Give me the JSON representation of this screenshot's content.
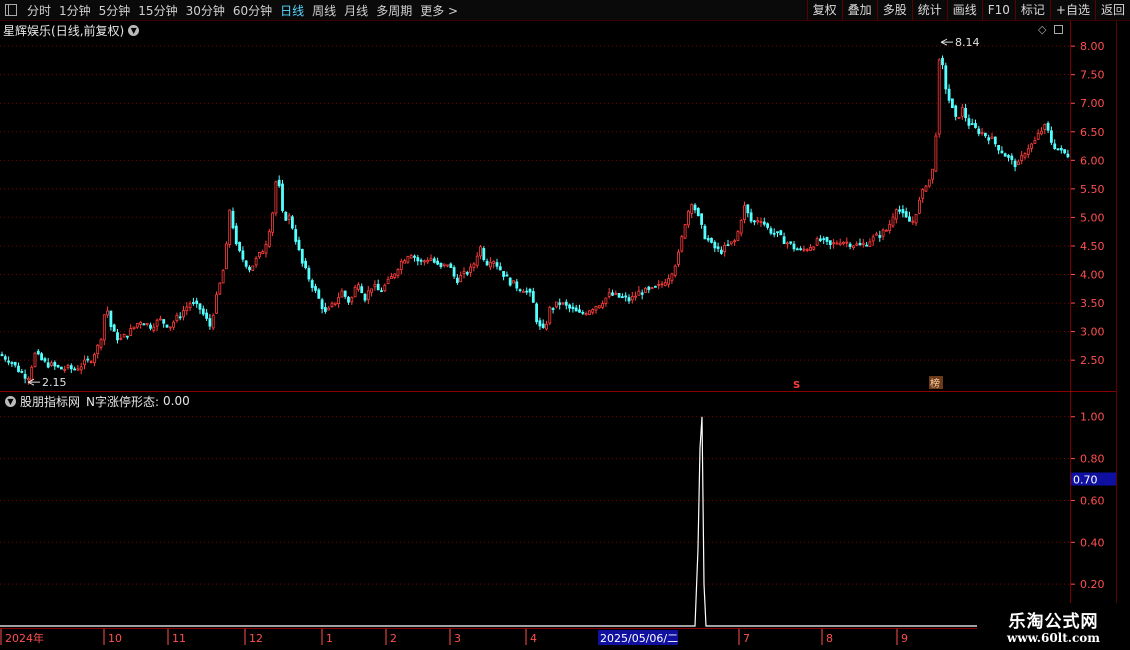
{
  "toolbar": {
    "periods": [
      "分时",
      "1分钟",
      "5分钟",
      "15分钟",
      "30分钟",
      "60分钟",
      "日线",
      "周线",
      "月线",
      "多周期",
      "更多"
    ],
    "active_period": "日线",
    "buttons": [
      "复权",
      "叠加",
      "多股",
      "统计",
      "画线",
      "F10",
      "标记",
      "+自选",
      "返回"
    ]
  },
  "stock": {
    "name": "星辉娱乐",
    "sub": "(日线,前复权)"
  },
  "indicator": {
    "name": "股朋指标网",
    "label": "N字涨停形态:",
    "value": "0.00",
    "current_marker": "0.70"
  },
  "markers": {
    "s_marker": "S",
    "bang_marker": "榜"
  },
  "xaxis": {
    "labels": [
      "2024年",
      "10",
      "11",
      "12",
      "1",
      "2",
      "3",
      "4",
      "2025/05/06/二",
      "7",
      "8",
      "9"
    ],
    "highlighted": "2025/05/06/二"
  },
  "watermark": {
    "line1": "乐淘公式网",
    "line2": "www.60lt.com"
  },
  "colors": {
    "up": "#ff3c3c",
    "down": "#54ffff",
    "grid": "#7a0000",
    "axis_text": "#ff5050",
    "indicator_line": "#ffffff",
    "marker_bg": "#1010a0"
  },
  "chart_data": [
    {
      "type": "candlestick",
      "title": "星辉娱乐(日线,前复权)",
      "ylim": [
        2.1,
        8.3
      ],
      "yticks": [
        2.5,
        3.0,
        3.5,
        4.0,
        4.5,
        5.0,
        5.5,
        6.0,
        6.5,
        7.0,
        7.5,
        8.0
      ],
      "ytick_labels": [
        "2.50",
        "3.00",
        "3.50",
        "4.00",
        "4.50",
        "5.00",
        "5.50",
        "6.00",
        "6.50",
        "7.00",
        "7.50",
        "8.00"
      ],
      "annotations": [
        {
          "text": "8.14",
          "value": 8.14,
          "kind": "high"
        },
        {
          "text": "2.15",
          "value": 2.15,
          "kind": "low"
        }
      ],
      "close_path": [
        [
          0,
          2.6
        ],
        [
          10,
          2.5
        ],
        [
          20,
          2.3
        ],
        [
          28,
          2.2
        ],
        [
          35,
          2.6
        ],
        [
          45,
          2.45
        ],
        [
          60,
          2.35
        ],
        [
          75,
          2.35
        ],
        [
          90,
          2.5
        ],
        [
          100,
          2.8
        ],
        [
          106,
          3.5
        ],
        [
          112,
          3.0
        ],
        [
          120,
          2.85
        ],
        [
          130,
          3.0
        ],
        [
          140,
          3.2
        ],
        [
          150,
          3.1
        ],
        [
          160,
          3.2
        ],
        [
          170,
          3.1
        ],
        [
          180,
          3.3
        ],
        [
          190,
          3.5
        ],
        [
          200,
          3.4
        ],
        [
          210,
          3.1
        ],
        [
          218,
          3.7
        ],
        [
          225,
          4.2
        ],
        [
          230,
          5.2
        ],
        [
          236,
          4.5
        ],
        [
          242,
          4.3
        ],
        [
          250,
          4.1
        ],
        [
          258,
          4.3
        ],
        [
          265,
          4.5
        ],
        [
          272,
          5.0
        ],
        [
          277,
          5.8
        ],
        [
          283,
          5.0
        ],
        [
          290,
          5.0
        ],
        [
          296,
          4.6
        ],
        [
          302,
          4.2
        ],
        [
          310,
          3.9
        ],
        [
          318,
          3.6
        ],
        [
          326,
          3.3
        ],
        [
          334,
          3.5
        ],
        [
          342,
          3.7
        ],
        [
          350,
          3.5
        ],
        [
          358,
          3.9
        ],
        [
          365,
          3.6
        ],
        [
          372,
          3.8
        ],
        [
          380,
          3.7
        ],
        [
          390,
          3.9
        ],
        [
          400,
          4.2
        ],
        [
          410,
          4.4
        ],
        [
          420,
          4.2
        ],
        [
          430,
          4.3
        ],
        [
          440,
          4.1
        ],
        [
          448,
          4.2
        ],
        [
          456,
          3.9
        ],
        [
          464,
          4.0
        ],
        [
          472,
          4.1
        ],
        [
          480,
          4.5
        ],
        [
          486,
          4.2
        ],
        [
          492,
          4.3
        ],
        [
          500,
          4.1
        ],
        [
          508,
          3.9
        ],
        [
          516,
          3.8
        ],
        [
          524,
          3.75
        ],
        [
          532,
          3.6
        ],
        [
          538,
          3.1
        ],
        [
          544,
          3.0
        ],
        [
          550,
          3.4
        ],
        [
          560,
          3.5
        ],
        [
          570,
          3.4
        ],
        [
          580,
          3.3
        ],
        [
          590,
          3.4
        ],
        [
          600,
          3.5
        ],
        [
          610,
          3.65
        ],
        [
          620,
          3.6
        ],
        [
          630,
          3.55
        ],
        [
          640,
          3.7
        ],
        [
          650,
          3.7
        ],
        [
          660,
          3.8
        ],
        [
          670,
          4.0
        ],
        [
          678,
          4.3
        ],
        [
          686,
          5.0
        ],
        [
          692,
          5.3
        ],
        [
          698,
          5.0
        ],
        [
          704,
          4.7
        ],
        [
          712,
          4.5
        ],
        [
          720,
          4.4
        ],
        [
          728,
          4.5
        ],
        [
          736,
          4.6
        ],
        [
          744,
          5.2
        ],
        [
          752,
          4.9
        ],
        [
          760,
          5.0
        ],
        [
          768,
          4.8
        ],
        [
          776,
          4.7
        ],
        [
          784,
          4.6
        ],
        [
          792,
          4.5
        ],
        [
          800,
          4.4
        ],
        [
          810,
          4.5
        ],
        [
          820,
          4.6
        ],
        [
          830,
          4.5
        ],
        [
          840,
          4.6
        ],
        [
          850,
          4.55
        ],
        [
          860,
          4.5
        ],
        [
          870,
          4.6
        ],
        [
          880,
          4.7
        ],
        [
          888,
          4.8
        ],
        [
          896,
          5.2
        ],
        [
          904,
          5.0
        ],
        [
          912,
          4.9
        ],
        [
          920,
          5.3
        ],
        [
          926,
          5.6
        ],
        [
          932,
          5.7
        ],
        [
          936,
          6.5
        ],
        [
          940,
          8.0
        ],
        [
          944,
          7.4
        ],
        [
          950,
          7.0
        ],
        [
          956,
          6.7
        ],
        [
          962,
          6.9
        ],
        [
          970,
          6.6
        ],
        [
          980,
          6.5
        ],
        [
          990,
          6.4
        ],
        [
          1000,
          6.2
        ],
        [
          1010,
          6.0
        ],
        [
          1018,
          5.9
        ],
        [
          1026,
          6.2
        ],
        [
          1034,
          6.3
        ],
        [
          1040,
          6.5
        ],
        [
          1046,
          6.6
        ],
        [
          1052,
          6.3
        ],
        [
          1060,
          6.15
        ],
        [
          1068,
          6.1
        ]
      ]
    },
    {
      "type": "line",
      "series_label": "N字涨停形态",
      "ylim": [
        0.0,
        1.08
      ],
      "yticks": [
        0.2,
        0.4,
        0.6,
        0.8,
        1.0
      ],
      "ytick_labels": [
        "0.20",
        "0.40",
        "0.60",
        "0.80",
        "1.00"
      ],
      "points": [
        [
          0,
          0
        ],
        [
          695,
          0
        ],
        [
          698,
          0.37
        ],
        [
          700,
          0.85
        ],
        [
          702,
          1.0
        ],
        [
          704,
          0.2
        ],
        [
          706,
          0
        ],
        [
          1070,
          0
        ]
      ]
    }
  ]
}
